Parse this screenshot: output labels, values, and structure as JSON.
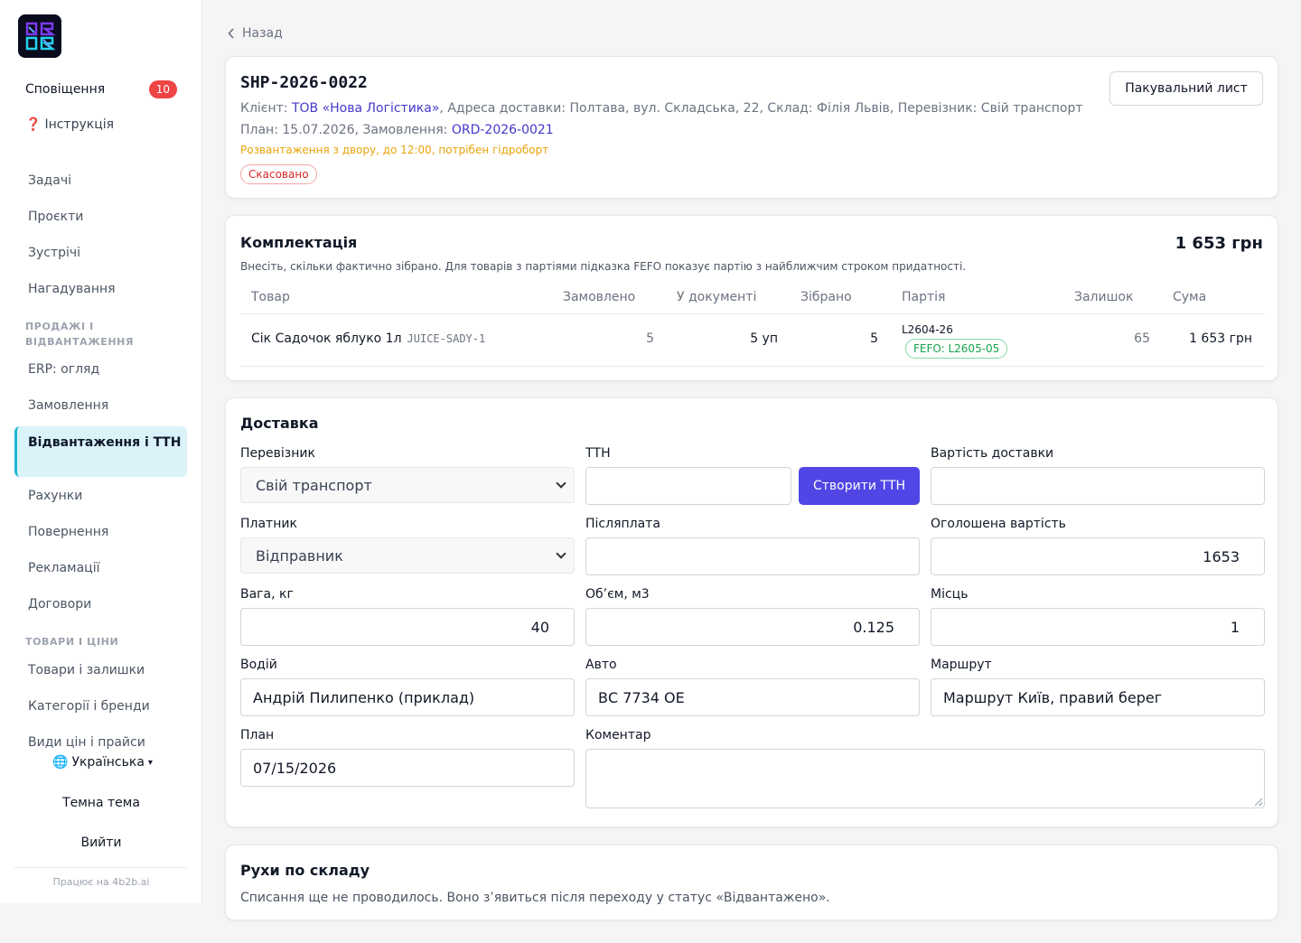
{
  "sidebar": {
    "notifications_label": "Сповіщення",
    "notifications_count": "10",
    "instructions_icon": "❓",
    "instructions_label": "Інструкція",
    "items_top": [
      "Задачі",
      "Проєкти",
      "Зустрічі",
      "Нагадування"
    ],
    "section_sales": "ПРОДАЖІ І ВІДВАНТАЖЕННЯ",
    "items_sales": [
      "ERP: огляд",
      "Замовлення",
      "Відвантаження і ТТН",
      "Рахунки",
      "Повернення",
      "Рекламації",
      "Договори"
    ],
    "section_goods": "ТОВАРИ І ЦІНИ",
    "items_goods": [
      "Товари і залишки",
      "Категорії і бренди",
      "Види цін і прайси"
    ],
    "language": "Українська",
    "language_icon": "🌐",
    "dark_theme": "Темна тема",
    "logout": "Вийти",
    "powered": "Працює на 4b2b.ai"
  },
  "back_label": "Назад",
  "shipment": {
    "id": "SHP-2026-0022",
    "client_label": "Клієнт:",
    "client": "ТОВ «Нова Логістика»",
    "rest_line": ", Адреса доставки: Полтава, вул. Складська, 22, Склад: Філія Львів, Перевізник: Свій транспорт",
    "plan_label": "План: 15.07.2026, Замовлення:",
    "order": "ORD-2026-0021",
    "note": "Розвантаження з двору, до 12:00, потрібен гідроборт",
    "status": "Скасовано",
    "packing_list_btn": "Пакувальний лист"
  },
  "picking": {
    "title": "Комплектація",
    "total": "1 653 грн",
    "hint": "Внесіть, скільки фактично зібрано. Для товарів з партіями підказка FEFO показує партію з найближчим строком придатності.",
    "columns": [
      "Товар",
      "Замовлено",
      "У документі",
      "Зібрано",
      "Партія",
      "Залишок",
      "Сума"
    ],
    "row": {
      "product": "Сік Садочок яблуко 1л",
      "sku": "JUICE-SADY-1",
      "ordered": "5",
      "in_doc": "5 уп",
      "picked": "5",
      "batch": "L2604-26",
      "fefo": "FEFO: L2605-05",
      "stock": "65",
      "sum": "1 653 грн"
    }
  },
  "delivery": {
    "title": "Доставка",
    "carrier_label": "Перевізник",
    "carrier_value": "Свій транспорт",
    "ttn_label": "ТТН",
    "ttn_value": "",
    "create_ttn_btn": "Створити ТТН",
    "delivery_cost_label": "Вартість доставки",
    "delivery_cost_value": "",
    "payer_label": "Платник",
    "payer_value": "Відправник",
    "cod_label": "Післяплата",
    "cod_value": "",
    "declared_label": "Оголошена вартість",
    "declared_value": "1653",
    "weight_label": "Вага, кг",
    "weight_value": "40",
    "volume_label": "Об’єм, м3",
    "volume_value": "0.125",
    "places_label": "Місць",
    "places_value": "1",
    "driver_label": "Водій",
    "driver_value": "Андрій Пилипенко (приклад)",
    "car_label": "Авто",
    "car_value": "ВС 7734 ОЕ",
    "route_label": "Маршрут",
    "route_value": "Маршрут Київ, правий берег",
    "plan_label": "План",
    "plan_value": "07/15/2026",
    "comment_label": "Коментар",
    "comment_value": ""
  },
  "moves": {
    "title": "Рухи по складу",
    "text": "Списання ще не проводилось. Воно з’явиться після переходу у статус «Відвантажено»."
  }
}
